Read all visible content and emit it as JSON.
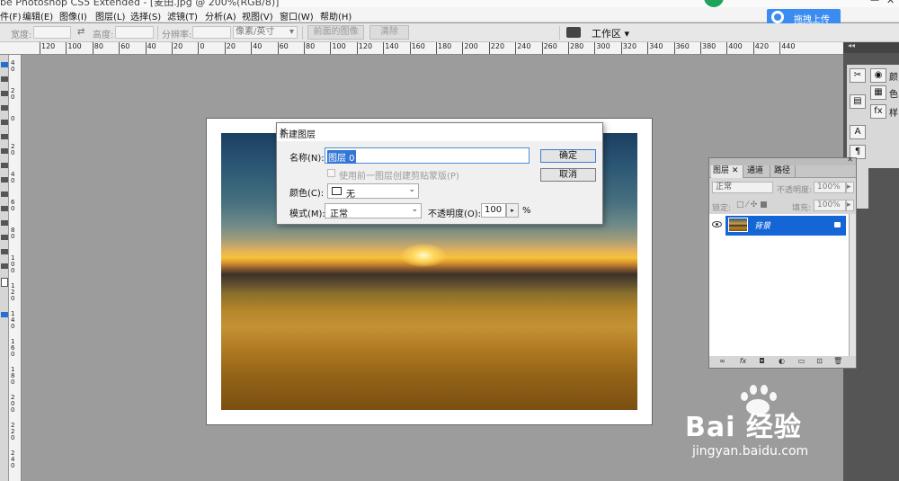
{
  "app": {
    "title": "be Photoshop CS5 Extended - [麦田.jpg @ 200%(RGB/8)]"
  },
  "menu": {
    "items": [
      "件(F)",
      "编辑(E)",
      "图像(I)",
      "图层(L)",
      "选择(S)",
      "滤镜(T)",
      "分析(A)",
      "视图(V)",
      "窗口(W)",
      "帮助(H)"
    ],
    "upload_label": "拖拽上传"
  },
  "options_bar": {
    "width_label": "宽度:",
    "height_label": "高度:",
    "resolution_label": "分辨率:",
    "unit_select": "像素/英寸",
    "front_image_button": "前面的图像",
    "clear_button": "清除",
    "workspace_label": "工作区"
  },
  "rulers": {
    "horizontal": [
      "120",
      "100",
      "80",
      "60",
      "40",
      "20",
      "0",
      "20",
      "40",
      "60",
      "80",
      "100",
      "120",
      "140",
      "160",
      "180",
      "200",
      "220",
      "240",
      "260",
      "280",
      "300",
      "320",
      "340",
      "360",
      "380",
      "400",
      "420",
      "440"
    ],
    "vertical": [
      "40",
      "20",
      "0",
      "20",
      "40",
      "60",
      "80",
      "100",
      "120",
      "140",
      "160",
      "180",
      "200",
      "220",
      "240"
    ]
  },
  "dialog": {
    "title": "新建图层",
    "name_label": "名称(N):",
    "name_value": "图层 0",
    "clip_mask_label": "使用前一图层创建剪贴蒙版(P)",
    "color_label": "颜色(C):",
    "color_value": "无",
    "mode_label": "模式(M):",
    "mode_value": "正常",
    "opacity_label": "不透明度(O):",
    "opacity_value": "100",
    "opacity_unit": "%",
    "ok_button": "确定",
    "cancel_button": "取消"
  },
  "right_dock": {
    "labels": [
      "颜",
      "色",
      "样"
    ]
  },
  "layers_panel": {
    "tabs": [
      "图层",
      "通道",
      "路径"
    ],
    "blend_mode": "正常",
    "opacity_label": "不透明度:",
    "opacity_value": "100%",
    "lock_label": "锁定:",
    "fill_label": "填充:",
    "fill_value": "100%",
    "layer_name": "背景"
  },
  "watermark": {
    "brand": "Bai 经验",
    "url": "jingyan.baidu.com"
  }
}
